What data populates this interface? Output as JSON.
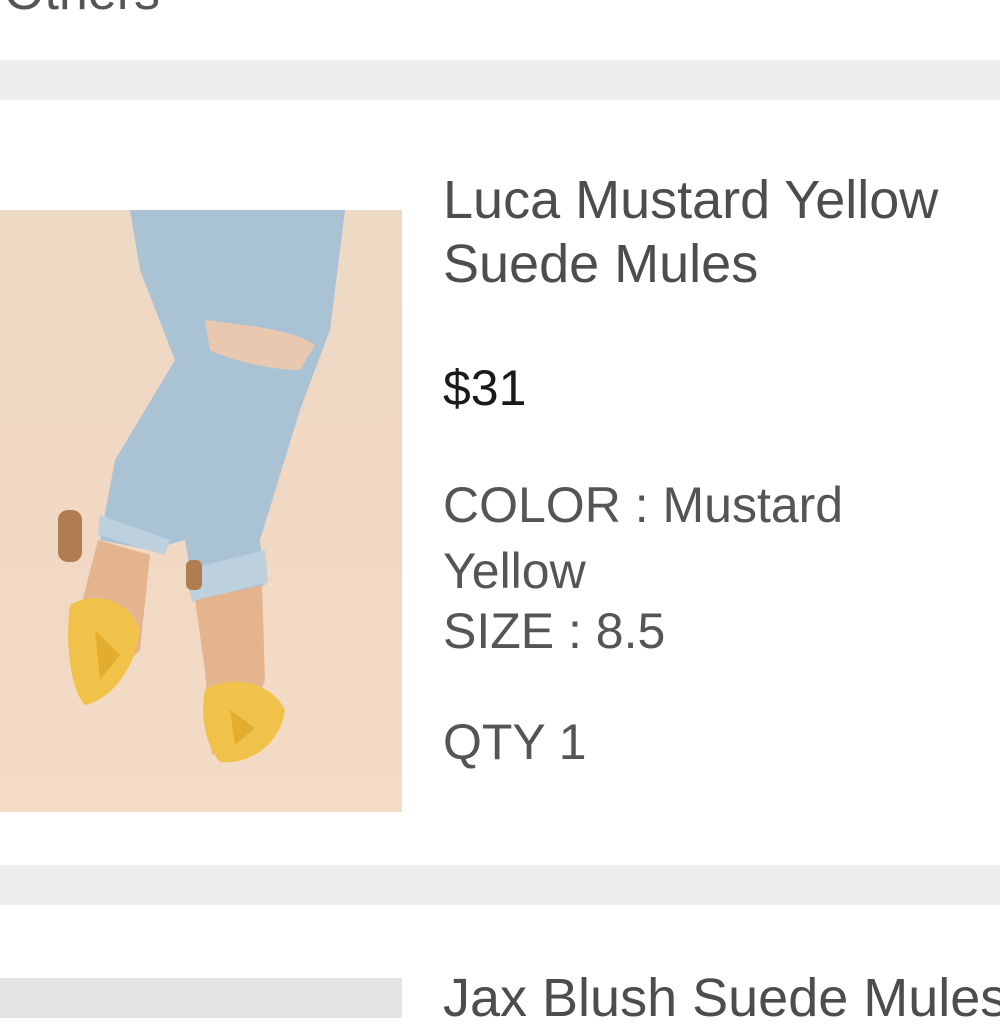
{
  "section": {
    "title": "Others"
  },
  "items": [
    {
      "title_line1": "Luca Mustard Yellow",
      "title_line2": "Suede Mules",
      "price": "$31",
      "color_line1": "COLOR : Mustard",
      "color_line2": "Yellow",
      "size": "SIZE : 8.5",
      "qty": "QTY 1",
      "image_icon": "product-photo-mules"
    },
    {
      "title_line1": "Jax Blush Suede Mules"
    }
  ],
  "colors": {
    "divider": "#eeeeee",
    "text": "#4d4d4d",
    "price": "#1a1a1a"
  }
}
